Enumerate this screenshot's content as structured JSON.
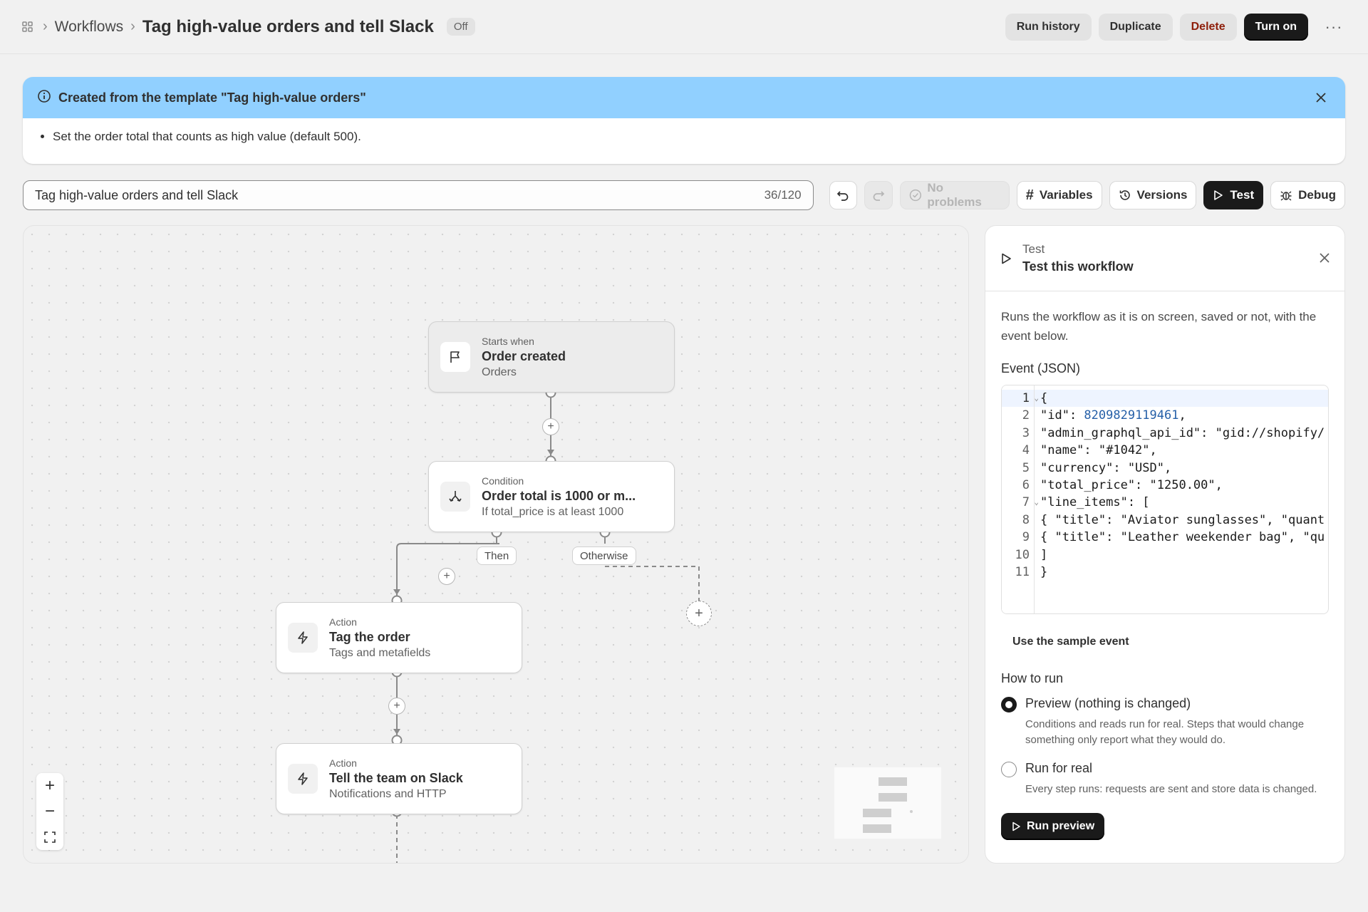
{
  "header": {
    "breadcrumb_parent": "Workflows",
    "title": "Tag high-value orders and tell Slack",
    "status_badge": "Off",
    "actions": {
      "run_history": "Run history",
      "duplicate": "Duplicate",
      "delete": "Delete",
      "turn_on": "Turn on"
    },
    "more_label": "···"
  },
  "banner": {
    "title": "Created from the template \"Tag high-value orders\"",
    "items": [
      "Set the order total that counts as high value (default 500)."
    ]
  },
  "toolbar": {
    "name_value": "Tag high-value orders and tell Slack",
    "char_count": "36/120",
    "status": "No problems",
    "variables": "Variables",
    "versions": "Versions",
    "test": "Test",
    "debug": "Debug"
  },
  "canvas": {
    "trigger": {
      "kicker": "Starts when",
      "title": "Order created",
      "sub": "Orders"
    },
    "condition": {
      "kicker": "Condition",
      "title": "Order total is 1000 or m...",
      "sub": "If total_price is at least 1000"
    },
    "branch_then": "Then",
    "branch_otherwise": "Otherwise",
    "action1": {
      "kicker": "Action",
      "title": "Tag the order",
      "sub": "Tags and metafields"
    },
    "action2": {
      "kicker": "Action",
      "title": "Tell the team on Slack",
      "sub": "Notifications and HTTP"
    }
  },
  "panel": {
    "kicker": "Test",
    "title": "Test this workflow",
    "description": "Runs the workflow as it is on screen, saved or not, with the event below.",
    "event_label": "Event (JSON)",
    "code_lines": [
      "{",
      "\"id\": 8209829119461,",
      "\"admin_graphql_api_id\": \"gid://shopify/",
      "\"name\": \"#1042\",",
      "\"currency\": \"USD\",",
      "\"total_price\": \"1250.00\",",
      "\"line_items\": [",
      "{ \"title\": \"Aviator sunglasses\", \"quant",
      "{ \"title\": \"Leather weekender bag\", \"qu",
      "]",
      "}"
    ],
    "sample_link": "Use the sample event",
    "how_to_run": "How to run",
    "options": [
      {
        "title": "Preview (nothing is changed)",
        "help": "Conditions and reads run for real. Steps that would change something only report what they would do.",
        "selected": true
      },
      {
        "title": "Run for real",
        "help": "Every step runs: requests are sent and store data is changed.",
        "selected": false
      }
    ],
    "run_button": "Run preview"
  },
  "colors": {
    "banner_bg": "#91d0ff",
    "primary_button": "#1a1a1a",
    "danger_text": "#8e1f0b",
    "code_number": "#2660a8"
  }
}
